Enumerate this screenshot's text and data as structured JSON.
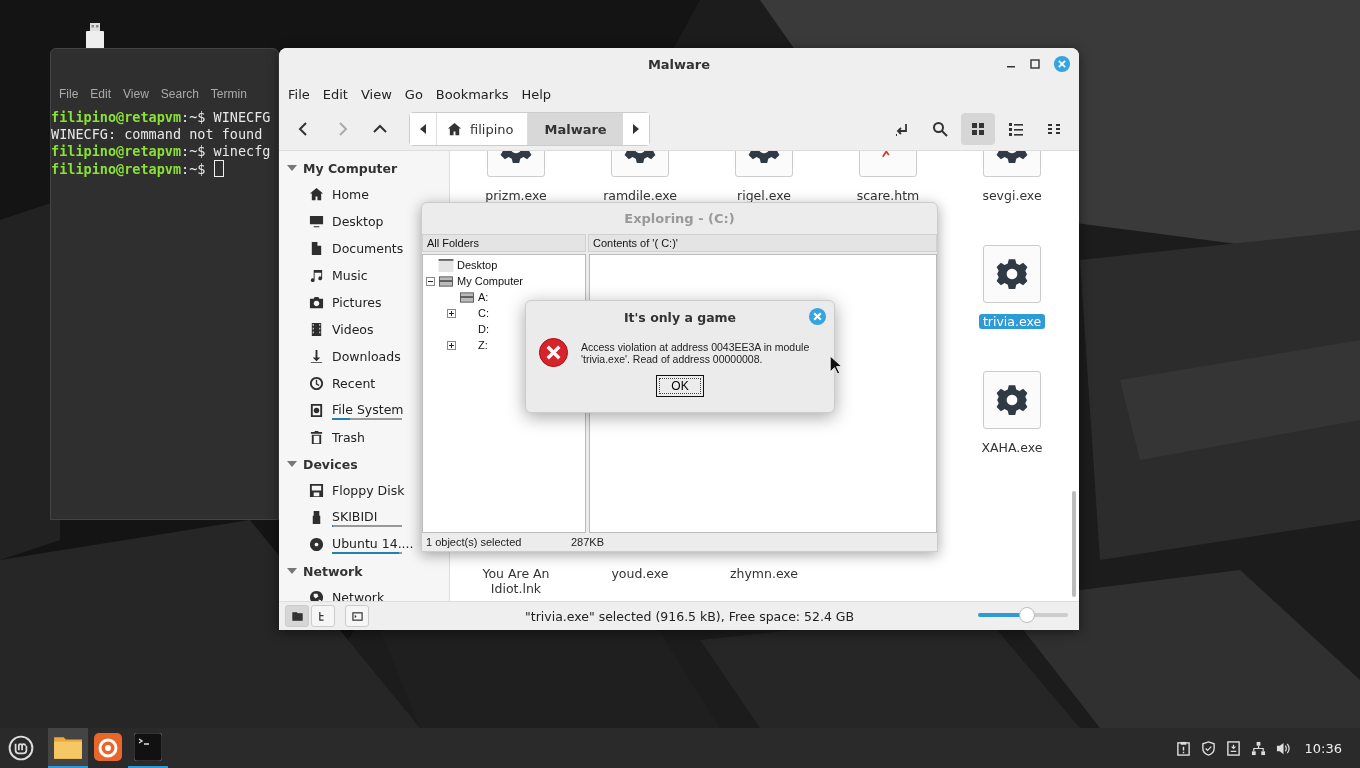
{
  "terminal": {
    "menu": [
      "File",
      "Edit",
      "View",
      "Search",
      "Termin"
    ],
    "lines": [
      {
        "kind": "prompt",
        "user": "filipino@retapvm",
        "path": ":~$ ",
        "command": "WINECFG",
        "cursor": false
      },
      {
        "kind": "output",
        "text": "WINECFG: command not found"
      },
      {
        "kind": "prompt",
        "user": "filipino@retapvm",
        "path": ":~$ ",
        "command": "winecfg",
        "cursor": false
      },
      {
        "kind": "prompt",
        "user": "filipino@retapvm",
        "path": ":~$ ",
        "cursor": true
      }
    ]
  },
  "file_manager": {
    "title": "Malware",
    "menu": [
      "File",
      "Edit",
      "View",
      "Go",
      "Bookmarks",
      "Help"
    ],
    "nav": [
      {
        "kind": "back",
        "disabled": false
      },
      {
        "kind": "forward",
        "disabled": true
      },
      {
        "kind": "up",
        "disabled": false
      }
    ],
    "breadcrumb": [
      {
        "label": "filipino",
        "kind": "home",
        "selected": false
      },
      {
        "label": "Malware",
        "kind": "folder",
        "selected": true
      }
    ],
    "view_modes": [
      {
        "kind": "icons",
        "selected": true
      },
      {
        "kind": "list",
        "selected": false
      },
      {
        "kind": "compact",
        "selected": false
      }
    ],
    "sidebar": [
      {
        "heading": "My Computer",
        "expanded": true,
        "items": [
          {
            "label": "Home",
            "kind": "home"
          },
          {
            "label": "Desktop",
            "kind": "desktop"
          },
          {
            "label": "Documents",
            "kind": "documents"
          },
          {
            "label": "Music",
            "kind": "music"
          },
          {
            "label": "Pictures",
            "kind": "pictures"
          },
          {
            "label": "Videos",
            "kind": "videos"
          },
          {
            "label": "Downloads",
            "kind": "downloads"
          },
          {
            "label": "Recent",
            "kind": "recent"
          },
          {
            "label": "File System",
            "kind": "filesystem",
            "level": 0.25
          },
          {
            "label": "Trash",
            "kind": "trash"
          }
        ]
      },
      {
        "heading": "Devices",
        "expanded": true,
        "items": [
          {
            "label": "Floppy Disk",
            "kind": "floppy"
          },
          {
            "label": "SKIBIDI",
            "kind": "usb",
            "level": 0.02
          },
          {
            "label": "Ubuntu 14....",
            "kind": "disc",
            "level": 0.95
          }
        ]
      },
      {
        "heading": "Network",
        "expanded": true,
        "items": [
          {
            "label": "Network",
            "kind": "network"
          }
        ]
      }
    ],
    "file_rows": [
      {
        "items": [
          {
            "name": "prizm.exe",
            "kind": "exe",
            "selected": false
          },
          {
            "name": "ramdile.exe",
            "kind": "exe",
            "selected": false
          },
          {
            "name": "rigel.exe",
            "kind": "exe",
            "selected": false
          },
          {
            "name": "scare.htm",
            "kind": "html",
            "selected": false
          },
          {
            "name": "sevgi.exe",
            "kind": "exe",
            "selected": false
          }
        ]
      },
      {
        "items": [
          {
            "name": "trivia.exe",
            "kind": "exe",
            "selected": true
          }
        ]
      },
      {
        "items": [
          {
            "name": "XAHA.exe",
            "kind": "exe",
            "selected": false
          }
        ]
      },
      {
        "items": [
          {
            "name": "You Are An Idiot.lnk",
            "selected": false
          },
          {
            "name": "youd.exe",
            "selected": false
          },
          {
            "name": "zhymn.exe",
            "selected": false
          }
        ]
      }
    ],
    "pane_buttons": [
      {
        "kind": "places",
        "selected": true
      },
      {
        "kind": "tree",
        "selected": false
      }
    ],
    "status": "\"trivia.exe\" selected (916.5 kB), Free space: 52.4 GB",
    "zoom": {
      "level": 0.5
    }
  },
  "explorer": {
    "title": "Exploring - (C:)",
    "active": false,
    "headers": [
      "All Folders",
      "Contents of '( C:)'"
    ],
    "tree": [
      {
        "label": "Desktop",
        "kind": "desktop"
      },
      {
        "label": "My Computer",
        "kind": "computer",
        "expanded": true,
        "children": [
          {
            "label": "A:",
            "kind": "drive"
          },
          {
            "label": "C:",
            "kind": "folder",
            "expanded": false
          },
          {
            "label": "D:",
            "kind": "folder"
          },
          {
            "label": "Z:",
            "kind": "folder",
            "expanded": false
          }
        ]
      }
    ],
    "status": [
      "1 object(s) selected",
      "287KB"
    ]
  },
  "dialog": {
    "title": "It's only a game",
    "kind": "error",
    "message": "Access violation at address 0043EE3A in module 'trivia.exe'. Read of address 00000008.",
    "button": "OK"
  },
  "taskbar": {
    "apps": [
      {
        "kind": "files",
        "active": true,
        "running": true
      },
      {
        "kind": "browser",
        "active": false,
        "running": false
      },
      {
        "kind": "terminal",
        "active": false,
        "running": true
      }
    ],
    "clock": "10:36"
  }
}
